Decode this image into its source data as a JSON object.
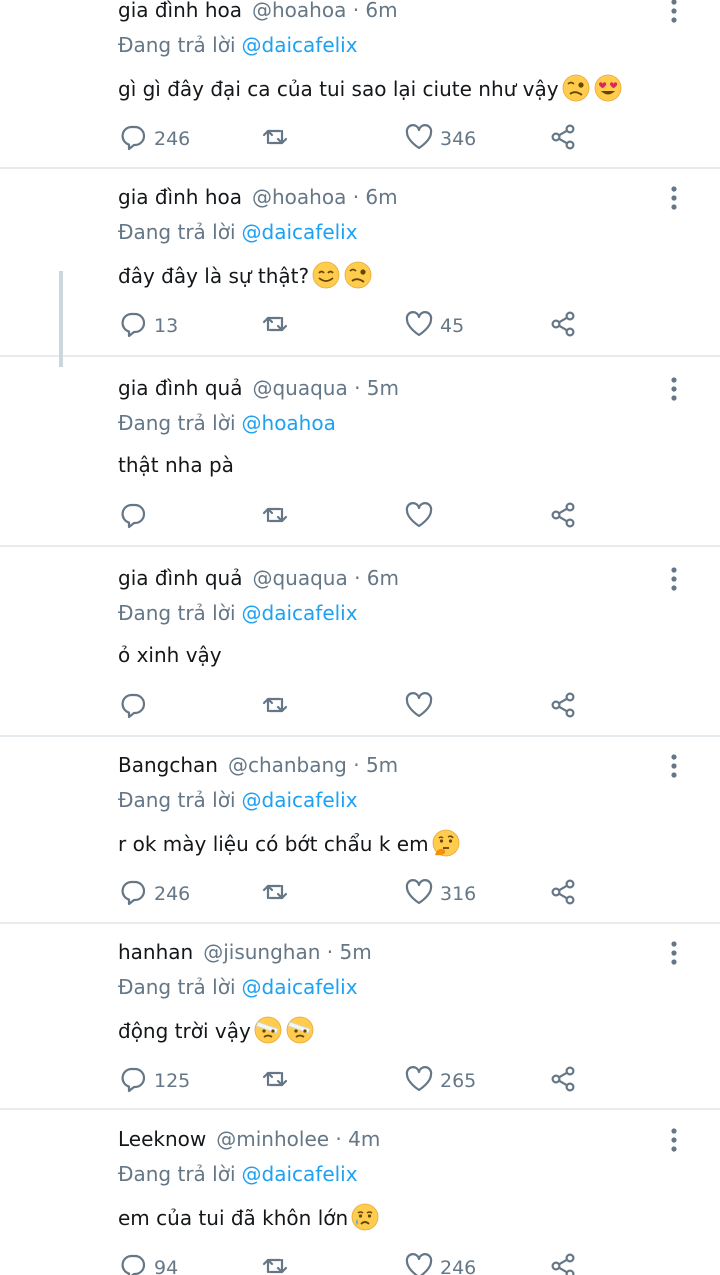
{
  "colors": {
    "link": "#1da1f2",
    "secondary_text": "#657786",
    "primary_text": "#14171a",
    "divider": "#e6ecf0",
    "thread_line": "#ccd6dd"
  },
  "tweets": [
    {
      "name": "gia đình hoa",
      "handle": "@hoahoa · 6m",
      "reply_prefix": "Đang trả lời",
      "reply_to": "@daicafelix",
      "text": "gì gì đây đại ca của tui sao lại ciute như vậy",
      "emojis": [
        "woozy-face",
        "heart-eyes-face"
      ],
      "avatar": "tulips-photo",
      "replies": "246",
      "retweets": "",
      "likes": "346"
    },
    {
      "name": "gia đình hoa",
      "handle": "@hoahoa · 6m",
      "reply_prefix": "Đang trả lời",
      "reply_to": "@daicafelix",
      "text": "đây đây là sự thật?",
      "emojis": [
        "grinning-squint-face",
        "woozy-face"
      ],
      "avatar": "tulips-photo",
      "replies": "13",
      "retweets": "",
      "likes": "45"
    },
    {
      "name": "gia đình quả",
      "handle": "@quaqua · 5m",
      "reply_prefix": "Đang trả lời",
      "reply_to": "@hoahoa",
      "text": "thật nha pà",
      "emojis": [],
      "avatar": "strawberries-photo",
      "replies": "",
      "retweets": "",
      "likes": ""
    },
    {
      "name": "gia đình quả",
      "handle": "@quaqua · 6m",
      "reply_prefix": "Đang trả lời",
      "reply_to": "@daicafelix",
      "text": "ỏ xinh vậy",
      "emojis": [],
      "avatar": "strawberries-photo",
      "replies": "",
      "retweets": "",
      "likes": ""
    },
    {
      "name": "Bangchan",
      "handle": "@chanbang · 5m",
      "reply_prefix": "Đang trả lời",
      "reply_to": "@daicafelix",
      "text": "r ok mày liệu có bớt chẩu k em",
      "emojis": [
        "thinking-face"
      ],
      "avatar": "person-photo",
      "replies": "246",
      "retweets": "",
      "likes": "316"
    },
    {
      "name": "hanhan",
      "handle": "@jisunghan · 5m",
      "reply_prefix": "Đang trả lời",
      "reply_to": "@daicafelix",
      "text": "động trời vậy",
      "emojis": [
        "bandage-face",
        "bandage-face"
      ],
      "avatar": "person-photo",
      "replies": "125",
      "retweets": "",
      "likes": "265"
    },
    {
      "name": "Leeknow",
      "handle": "@minholee · 4m",
      "reply_prefix": "Đang trả lời",
      "reply_to": "@daicafelix",
      "text": "em của tui đã khôn lớn",
      "emojis": [
        "crying-face"
      ],
      "avatar": "person-photo",
      "replies": "94",
      "retweets": "",
      "likes": "246"
    }
  ]
}
